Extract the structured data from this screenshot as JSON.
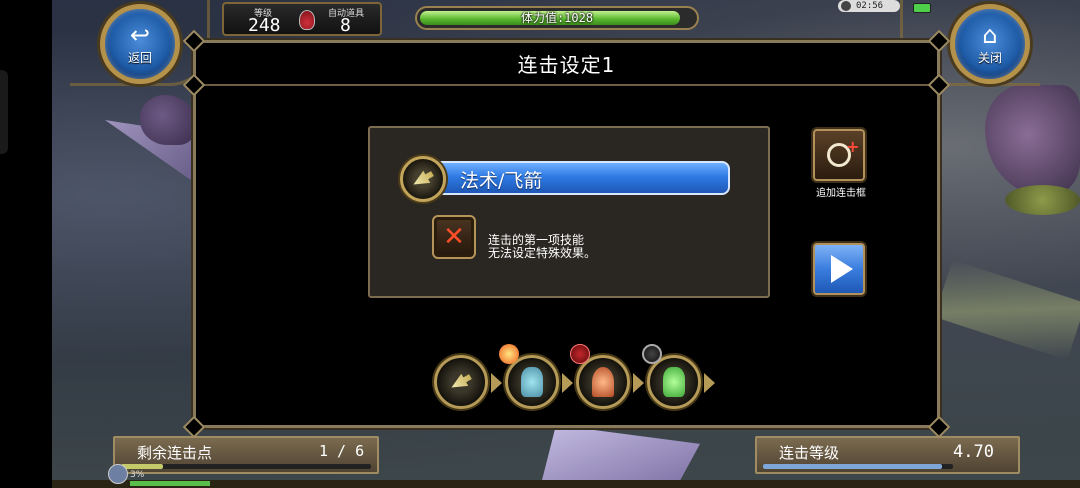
{
  "hud": {
    "back_label": "返回",
    "close_label": "关闭",
    "level_label": "等级",
    "level_value": "248",
    "auto_item_label": "自动道具",
    "auto_item_value": "8",
    "stamina_text": "体力值:1028",
    "stamina_fill": 0.95,
    "clock": "02:56"
  },
  "panel": {
    "title": "连击设定1",
    "skill_name": "法术/飞箭",
    "warning_text_1": "连击的第一项技能",
    "warning_text_2": "无法设定特殊效果。",
    "add_frame_label": "追加连击框"
  },
  "chain_slots": [
    {
      "name": "arrow-skill",
      "icon": "arrow-icon"
    },
    {
      "name": "blue-figure",
      "icon": "blue-figure-icon",
      "badge": "fire-badge-icon"
    },
    {
      "name": "red-figure",
      "icon": "red-figure-icon",
      "badge": "red-badge-icon"
    },
    {
      "name": "green-figure",
      "icon": "green-figure-icon",
      "badge": "dark-badge-icon"
    }
  ],
  "bottom": {
    "remaining_label": "剩余连击点",
    "remaining_value": "1 / 6",
    "remaining_fill": 0.167,
    "combo_level_label": "连击等级",
    "combo_level_value": "4.70",
    "combo_level_fill": 0.94,
    "percent_text": "3%"
  },
  "colors": {
    "accent_blue": "#2f7be4",
    "gold_border": "#b5924a",
    "stamina_green": "#57b52c",
    "warning_red": "#ff4e28"
  }
}
